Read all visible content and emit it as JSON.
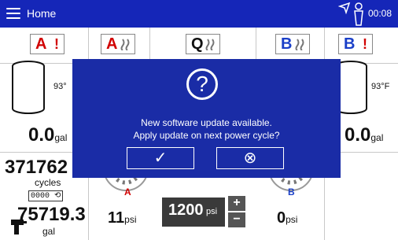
{
  "header": {
    "title": "Home",
    "time": "00:08"
  },
  "tiles": [
    {
      "letter": "A",
      "mark": "!",
      "letter_color": "#d10000"
    },
    {
      "letter": "A",
      "mark": "",
      "letter_color": "#d10000"
    },
    {
      "letter": "Q",
      "mark": "",
      "letter_color": "#111111"
    },
    {
      "letter": "B",
      "mark": "",
      "letter_color": "#1a3fc8"
    },
    {
      "letter": "B",
      "mark": "!",
      "letter_color": "#1a3fc8"
    }
  ],
  "tanks": {
    "left": {
      "temp": "93°",
      "amount": "0.0",
      "unit": "gal"
    },
    "right": {
      "temp": "93°F",
      "amount": "0.0",
      "unit": "gal"
    }
  },
  "stats": {
    "cycles_value": "371762",
    "cycles_label": "cycles",
    "counter": "0000",
    "total_value": "75719.3",
    "total_unit": "gal"
  },
  "pressure": {
    "a_value": "11",
    "a_unit": "psi",
    "setpoint": "1200",
    "setpoint_unit": "psi",
    "b_value": "0",
    "b_unit": "psi",
    "plus": "+",
    "minus": "−",
    "gauge_a_label": "A",
    "gauge_b_label": "B"
  },
  "dialog": {
    "icon": "?",
    "line1": "New software update available.",
    "line2": "Apply update on next power cycle?",
    "confirm": "✓",
    "cancel": "⊗"
  },
  "colors": {
    "header_bg": "#1526b8",
    "dialog_bg": "#1a2ca6",
    "alert_red": "#d10000",
    "b_blue": "#1a3fc8"
  }
}
